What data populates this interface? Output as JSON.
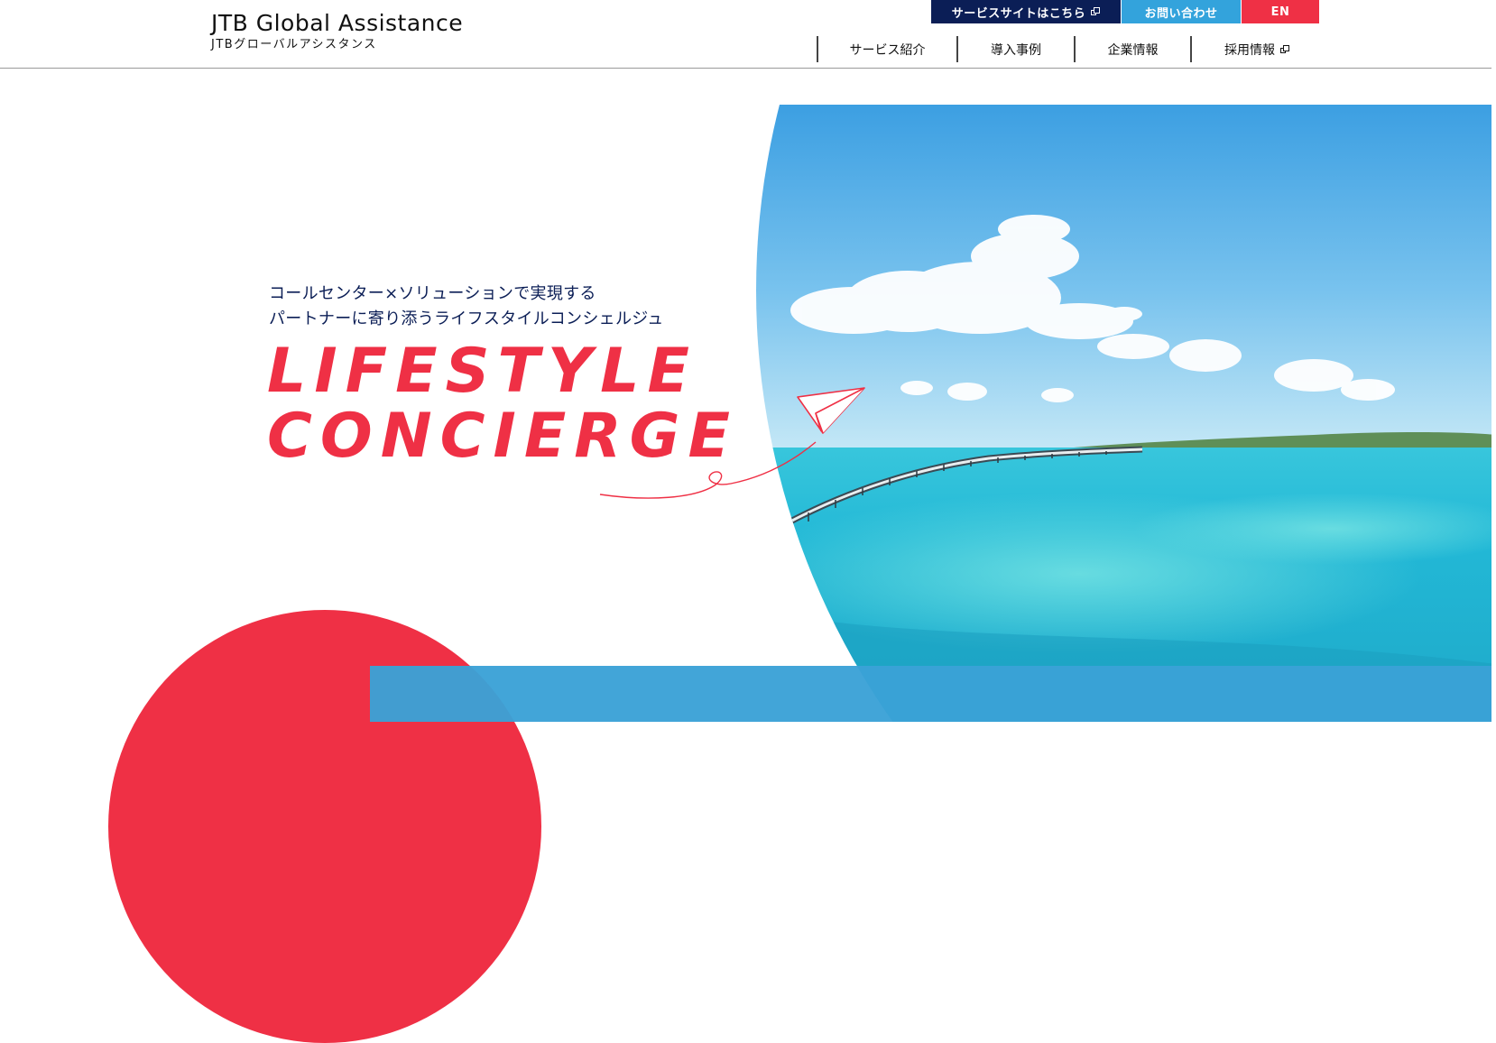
{
  "header": {
    "logo_en": "JTB Global Assistance",
    "logo_ja": "JTBグローバルアシスタンス",
    "utility": {
      "service_site": "サービスサイトはこちら",
      "contact": "お問い合わせ",
      "language": "EN"
    },
    "nav": {
      "services": "サービス紹介",
      "cases": "導入事例",
      "company": "企業情報",
      "recruit": "採用情報"
    }
  },
  "hero": {
    "tagline_line1": "コールセンター×ソリューションで実現する",
    "tagline_line2": "パートナーに寄り添うライフスタイルコンシェルジュ",
    "title_line1": "LIFESTYLE",
    "title_line2": "CONCIERGE"
  },
  "colors": {
    "navy": "#0b1e56",
    "sky_blue": "#33a3dc",
    "red": "#ef3045"
  },
  "icons": {
    "external_link": "external-link-icon",
    "paper_plane": "paper-plane-icon"
  }
}
